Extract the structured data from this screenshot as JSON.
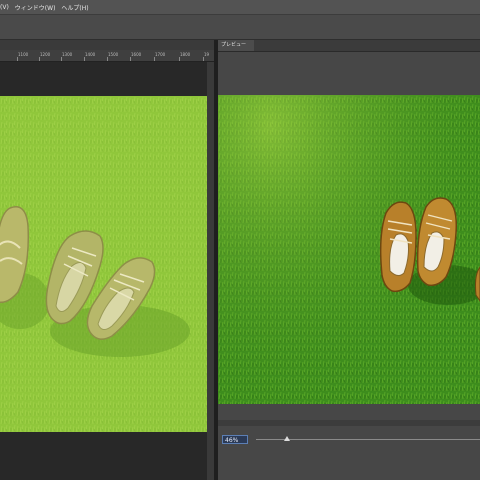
{
  "menu": {
    "items": [
      "(V)",
      "ウィンドウ(W)",
      "ヘルプ(H)"
    ]
  },
  "ruler": {
    "ticks": [
      "1100",
      "1200",
      "1300",
      "1400",
      "1500",
      "1600",
      "1700",
      "1800",
      "19"
    ]
  },
  "preview": {
    "tab_label": "プレビュー",
    "zoom_value": "46%"
  },
  "colors": {
    "accent": "#5c7fb5",
    "grass_tinted": "#8cc63a",
    "grass_natural": "#3f8f1e"
  }
}
